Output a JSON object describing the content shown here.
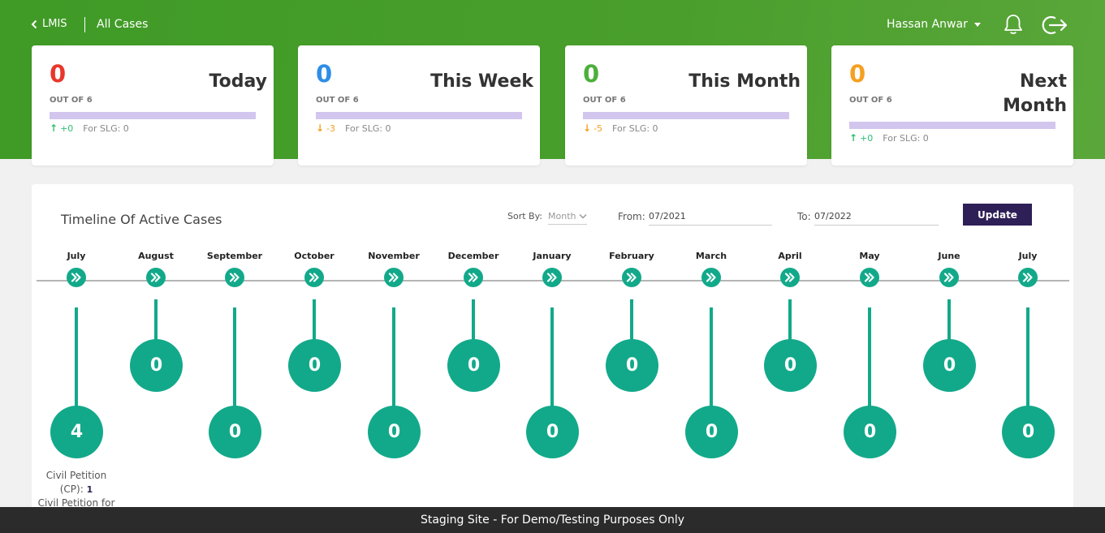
{
  "header": {
    "back_label": "LMIS",
    "breadcrumb": "All Cases",
    "user_name": "Hassan Anwar",
    "colors": {
      "green": "#4a9f2c",
      "accent_purple": "#2e1f57",
      "teal": "#12a98a"
    }
  },
  "cards": [
    {
      "count": "0",
      "count_color": "#e8372b",
      "title": "Today",
      "out_of": "OUT OF 6",
      "trend": "up",
      "delta": "+0",
      "slg": "For SLG: 0"
    },
    {
      "count": "0",
      "count_color": "#2e8ee6",
      "title": "This Week",
      "out_of": "OUT OF 6",
      "trend": "down",
      "delta": "-3",
      "slg": "For SLG: 0"
    },
    {
      "count": "0",
      "count_color": "#4caf3c",
      "title": "This Month",
      "out_of": "OUT OF 6",
      "trend": "down",
      "delta": "-5",
      "slg": "For SLG: 0"
    },
    {
      "count": "0",
      "count_color": "#f5a020",
      "title": "Next Month",
      "out_of": "OUT OF 6",
      "trend": "up",
      "delta": "+0",
      "slg": "For SLG: 0"
    }
  ],
  "timeline": {
    "title": "Timeline Of Active Cases",
    "sort_label": "Sort By:",
    "sort_value": "Month",
    "from_label": "From:",
    "from_value": "07/2021",
    "to_label": "To:",
    "to_value": "07/2022",
    "update_label": "Update",
    "months": [
      {
        "name": "July",
        "count": "4"
      },
      {
        "name": "August",
        "count": "0"
      },
      {
        "name": "September",
        "count": "0"
      },
      {
        "name": "October",
        "count": "0"
      },
      {
        "name": "November",
        "count": "0"
      },
      {
        "name": "December",
        "count": "0"
      },
      {
        "name": "January",
        "count": "0"
      },
      {
        "name": "February",
        "count": "0"
      },
      {
        "name": "March",
        "count": "0"
      },
      {
        "name": "April",
        "count": "0"
      },
      {
        "name": "May",
        "count": "0"
      },
      {
        "name": "June",
        "count": "0"
      },
      {
        "name": "July",
        "count": "0"
      }
    ],
    "detail": {
      "line1": "Civil Petition",
      "line2_label": "(CP):",
      "line2_value": "1",
      "line3": "Civil Petition for"
    }
  },
  "footer_text": "Staging Site - For Demo/Testing Purposes Only"
}
